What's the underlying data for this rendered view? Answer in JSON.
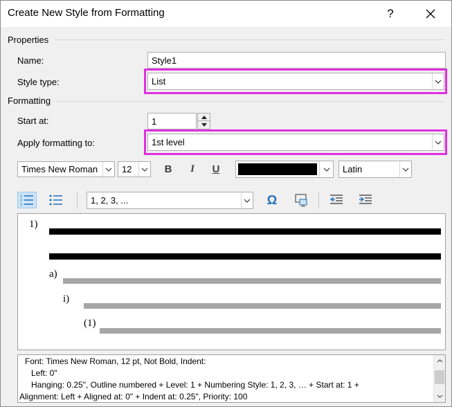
{
  "window": {
    "title": "Create New Style from Formatting",
    "help_glyph": "?",
    "close_glyph": "✕"
  },
  "properties": {
    "section_label": "Properties",
    "name_label": "Name:",
    "name_value": "Style1",
    "style_type_label": "Style type:",
    "style_type_value": "List"
  },
  "formatting": {
    "section_label": "Formatting",
    "start_at_label": "Start at:",
    "start_at_value": "1",
    "apply_to_label": "Apply formatting to:",
    "apply_to_value": "1st level",
    "font_name": "Times New Roman",
    "font_size": "12",
    "bold_label": "B",
    "italic_label": "I",
    "underline_label": "U",
    "font_color": "#000000",
    "script": "Latin",
    "numbering_style": "1, 2, 3, ...",
    "insert_symbol_glyph": "Ω"
  },
  "preview": {
    "level1": "1)",
    "level2": "a)",
    "level3": "i)",
    "level4": "(1)"
  },
  "description": {
    "line1": "Font: Times New Roman, 12 pt, Not Bold, Indent:",
    "line2": "Left:  0\"",
    "line3": "Hanging:  0.25\", Outline numbered + Level: 1 + Numbering Style: 1, 2, 3, … + Start at: 1 +",
    "line4": "Alignment: Left + Aligned at:  0\" + Indent at:  0.25\", Priority: 100"
  },
  "colors": {
    "highlight": "#e030e0",
    "dialog_bg": "#f0f0f0",
    "accent_blue": "#1e6fb8"
  }
}
